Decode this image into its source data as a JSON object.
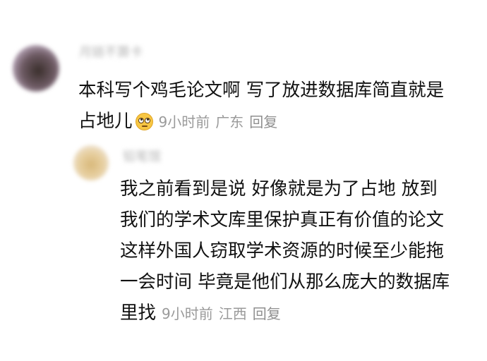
{
  "comment": {
    "username": "月链不算卡",
    "lines": [
      "本科写个鸡毛论文啊 写了放进数据库简直就是",
      "占地儿"
    ],
    "emoji": "rolling-eyes-emoji",
    "time": "9小时前",
    "location": "广东",
    "reply_label": "回复"
  },
  "reply": {
    "username": "铅笔馆",
    "lines": [
      "我之前看到是说 好像就是为了占地 放到",
      "我们的学术文库里保护真正有价值的论文",
      "这样外国人窃取学术资源的时候至少能拖",
      "一会时间 毕竟是他们从那么庞大的数据库",
      "里找"
    ],
    "time": "9小时前",
    "location": "江西",
    "reply_label": "回复"
  }
}
